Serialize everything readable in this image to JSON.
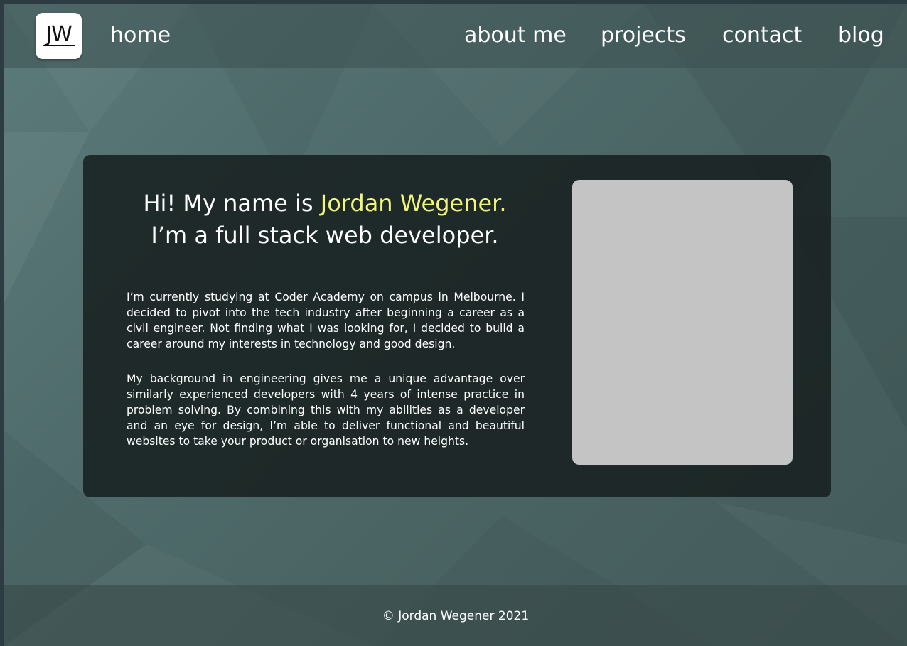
{
  "nav": {
    "logo_text": "JW",
    "home": "home",
    "about": "about me",
    "projects": "projects",
    "contact": "contact",
    "blog": "blog"
  },
  "hero": {
    "greeting": "Hi! My name is ",
    "name": "Jordan Wegener.",
    "tagline": "I’m a full stack web developer.",
    "paragraph_1": "I’m currently studying at Coder Academy on campus in Melbourne. I decided to pivot into the tech industry after beginning a career as a civil engineer. Not finding what I was looking for, I decided to build a career around my interests in technology and good design.",
    "paragraph_2": "My background in engineering gives me a unique advantage over similarly experienced developers with 4 years of intense practice in problem solving. By combining this with my abilities as a developer and an eye for design, I’m able to deliver functional and beautiful websites to take your product or organisation to new heights."
  },
  "footer": {
    "copyright": "© Jordan Wegener 2021"
  },
  "colors": {
    "accent": "#f2f57a",
    "card": "#182020",
    "photo_placeholder": "#c4c4c4"
  }
}
